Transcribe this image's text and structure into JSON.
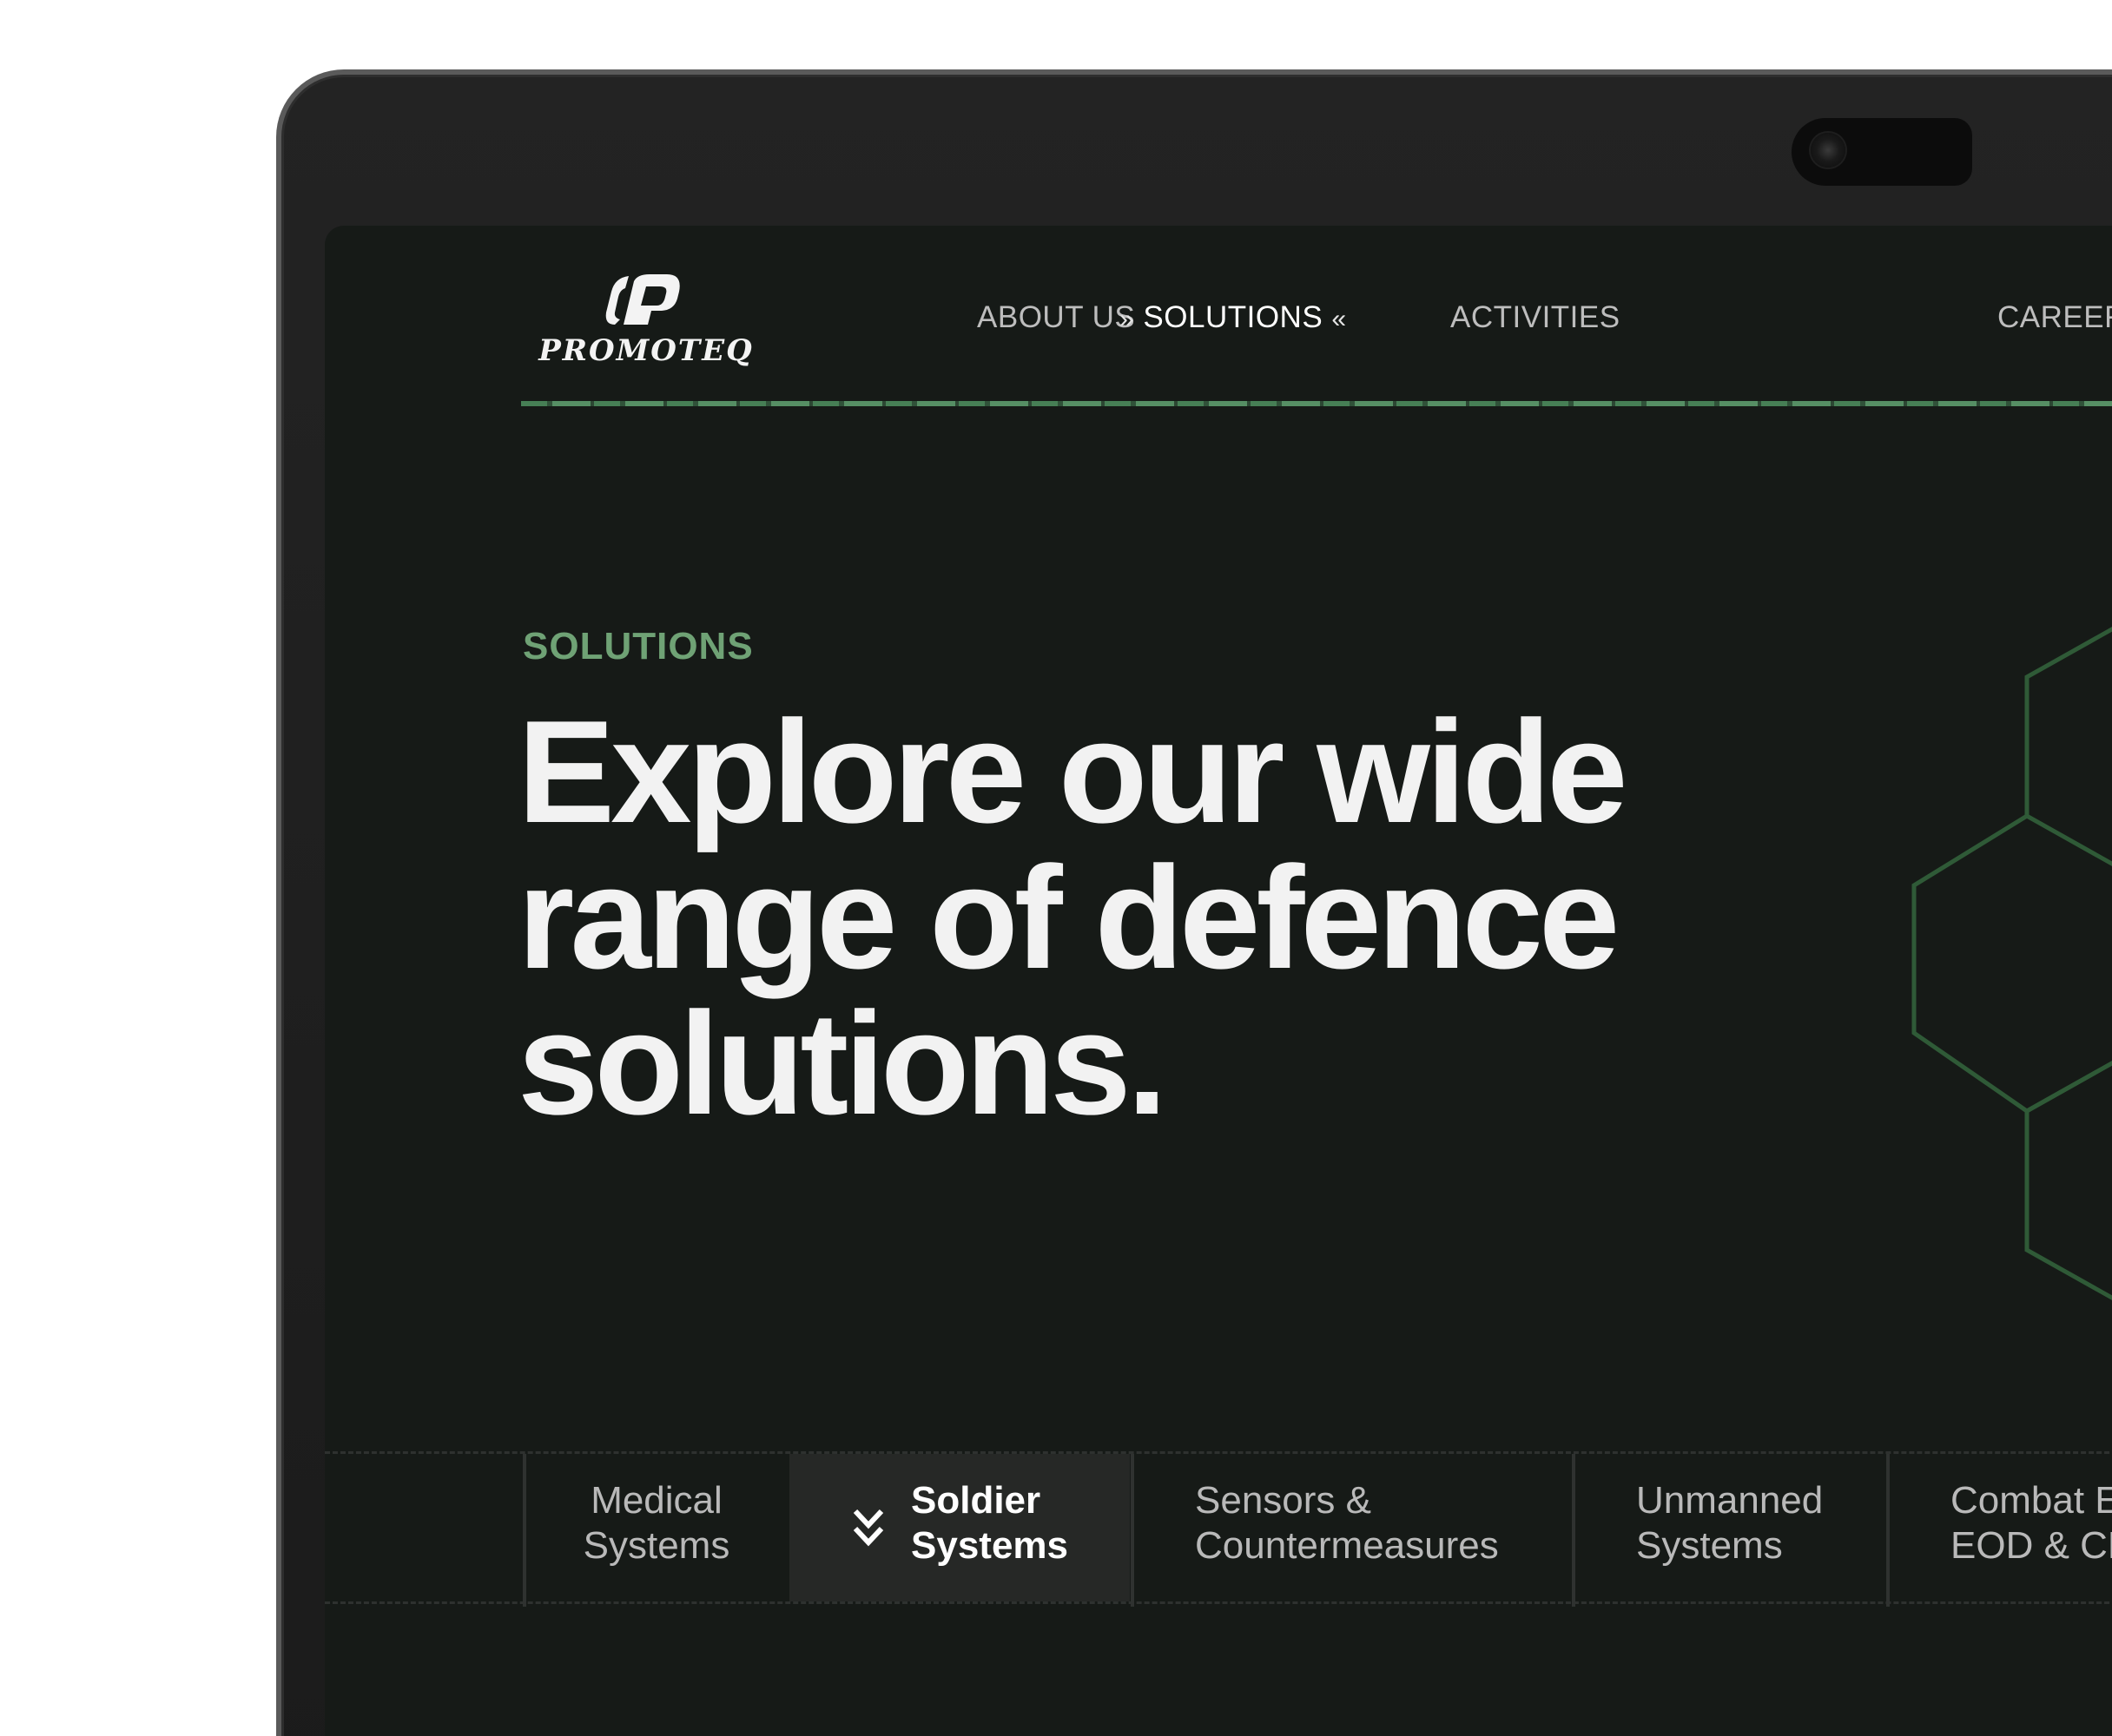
{
  "brand": {
    "name": "PROMOTEQ"
  },
  "nav": {
    "items": [
      "ABOUT US",
      "SOLUTIONS",
      "ACTIVITIES",
      "CAREER"
    ],
    "active_left_arrows": "»",
    "active_right_arrows": "«"
  },
  "hero": {
    "eyebrow": "SOLUTIONS",
    "headline_lines": [
      "Explore our wide",
      "range of defence",
      "solutions."
    ]
  },
  "tabs": [
    {
      "lines": [
        "Medical",
        "Systems"
      ]
    },
    {
      "lines": [
        "Soldier",
        "Systems"
      ]
    },
    {
      "lines": [
        "Sensors &",
        "Countermeasures"
      ]
    },
    {
      "lines": [
        "Unmanned",
        "Systems"
      ]
    },
    {
      "lines": [
        "Combat E",
        "EOD & CB"
      ]
    }
  ],
  "colors": {
    "accent": "#6fa275",
    "background": "#161a17",
    "hex_outline": "#2f5a37"
  },
  "icons": {
    "active_tab": "chevron-double-down-icon",
    "nav_active": "double-chevron-icon"
  }
}
